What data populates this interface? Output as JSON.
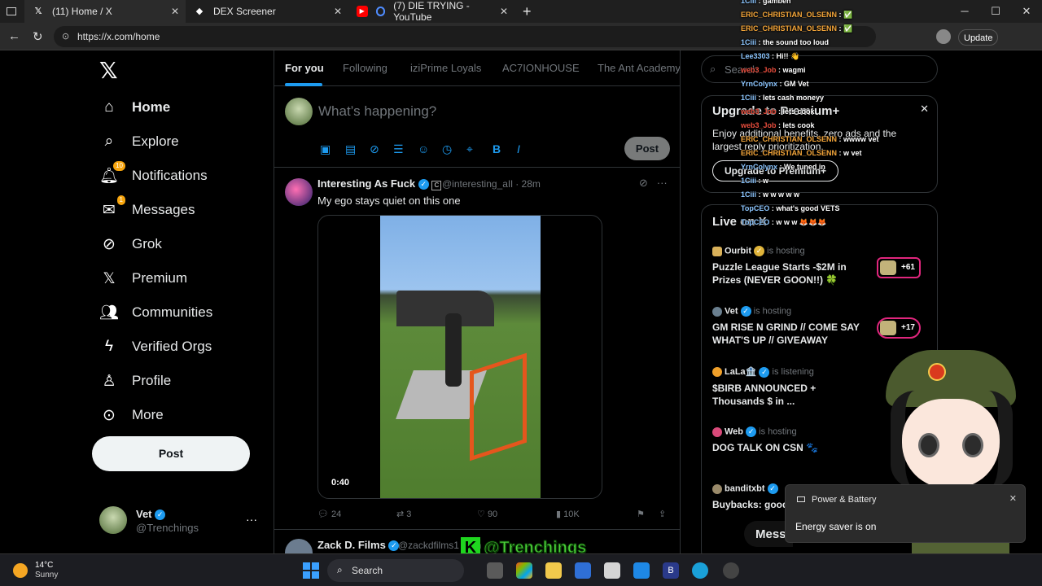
{
  "browser": {
    "tabs": [
      {
        "title": "(11) Home / X",
        "icon": "x-logo-icon",
        "active": true
      },
      {
        "title": "DEX Screener",
        "icon": "dexscreener-icon",
        "active": false
      },
      {
        "title": "(7) DIE TRYING - YouTube",
        "icon": "youtube-icon",
        "active": false
      }
    ],
    "url": "https://x.com/home",
    "update_label": "Update"
  },
  "sidebar": {
    "items": [
      {
        "label": "Home",
        "icon": "home-icon"
      },
      {
        "label": "Explore",
        "icon": "search-icon"
      },
      {
        "label": "Notifications",
        "icon": "bell-icon",
        "badge": "10"
      },
      {
        "label": "Messages",
        "icon": "envelope-icon",
        "badge": "1"
      },
      {
        "label": "Grok",
        "icon": "grok-icon"
      },
      {
        "label": "Premium",
        "icon": "x-logo-icon"
      },
      {
        "label": "Communities",
        "icon": "people-icon"
      },
      {
        "label": "Verified Orgs",
        "icon": "lightning-icon"
      },
      {
        "label": "Profile",
        "icon": "person-icon"
      },
      {
        "label": "More",
        "icon": "more-circle-icon"
      }
    ],
    "post_label": "Post",
    "account": {
      "name": "Vet",
      "handle": "@Trenchings"
    }
  },
  "feed": {
    "tabs": [
      "For you",
      "Following",
      "iziPrime Loyals",
      "AC7IONHOUSE",
      "The Ant Academy"
    ],
    "composer": {
      "placeholder": "What’s happening?",
      "post_label": "Post"
    },
    "tweet": {
      "name": "Interesting As Fuck",
      "handle": "@interesting_aIl · 28m",
      "text": "My ego stays quiet on this one",
      "video_time": "0:40",
      "replies": "24",
      "reposts": "3",
      "likes": "90",
      "views": "10K"
    },
    "tweet2": {
      "name": "Zack D. Films",
      "handle": "@zackdfilms1 · 1m"
    }
  },
  "right": {
    "search_placeholder": "Search",
    "premium": {
      "title": "Upgrade to Premium+",
      "body": "Enjoy additional benefits, zero ads and the largest reply prioritization.",
      "button": "Upgrade to Premium+"
    },
    "live": {
      "title": "Live on X",
      "items": [
        {
          "host": "Ourbit",
          "status": "is hosting",
          "title": "Puzzle League Starts -$2M in Prizes (NEVER GOON!!) 🍀",
          "count": "+61"
        },
        {
          "host": "Vet",
          "status": "is hosting",
          "title": "GM RISE N GRIND // COME SAY WHAT'S UP // GIVEAWAY",
          "count": "+17"
        },
        {
          "host": "LaLa🏦",
          "status": "is listening",
          "title": "$BIRB ANNOUNCED + Thousands $ in ...",
          "count": ""
        },
        {
          "host": "Web",
          "status": "is hosting",
          "title": "DOG TALK ON CSN 🐾",
          "count": ""
        },
        {
          "host": "banditxbt",
          "status": "",
          "title": "Buybacks: good or the ugh...",
          "count": ""
        }
      ]
    },
    "messages_label": "Mess"
  },
  "overlay": {
    "chat": [
      {
        "user": "1Ciii",
        "msg": "gambeh",
        "color": "blue"
      },
      {
        "user": "ERIC_CHRISTIAN_OLSENN",
        "msg": "✅",
        "color": "orange"
      },
      {
        "user": "ERIC_CHRISTIAN_OLSENN",
        "msg": "✅",
        "color": "orange"
      },
      {
        "user": "1Ciii",
        "msg": "the sound too loud",
        "color": "blue"
      },
      {
        "user": "Lee3303",
        "msg": "Hi!! 👋",
        "color": "blue"
      },
      {
        "user": "web3_Job",
        "msg": "wagmi",
        "color": "red"
      },
      {
        "user": "YrnColynx",
        "msg": "GM Vet",
        "color": "blue"
      },
      {
        "user": "1Ciii",
        "msg": "lets cash moneyy",
        "color": "blue"
      },
      {
        "user": "web3_Job",
        "msg": "lets cook",
        "color": "red"
      },
      {
        "user": "web3_Job",
        "msg": "lets cook",
        "color": "red"
      },
      {
        "user": "ERIC_CHRISTIAN_OLSENN",
        "msg": "wwww vet",
        "color": "orange"
      },
      {
        "user": "ERIC_CHRISTIAN_OLSENN",
        "msg": "w vet",
        "color": "orange"
      },
      {
        "user": "YrnColynx",
        "msg": "We tuned in",
        "color": "blue"
      },
      {
        "user": "1Ciii",
        "msg": "w",
        "color": "blue"
      },
      {
        "user": "1Ciii",
        "msg": "w w w w w",
        "color": "blue"
      },
      {
        "user": "TopCEO",
        "msg": "what's good VETS",
        "color": "blue"
      },
      {
        "user": "TopCEO",
        "msg": "w w w 🦊🦊🦊",
        "color": "blue"
      }
    ],
    "watermark": "@Trenchings",
    "toast": {
      "title": "Power & Battery",
      "body": "Energy saver is on"
    }
  },
  "taskbar": {
    "temp": "14°C",
    "weather": "Sunny",
    "search": "Search"
  }
}
